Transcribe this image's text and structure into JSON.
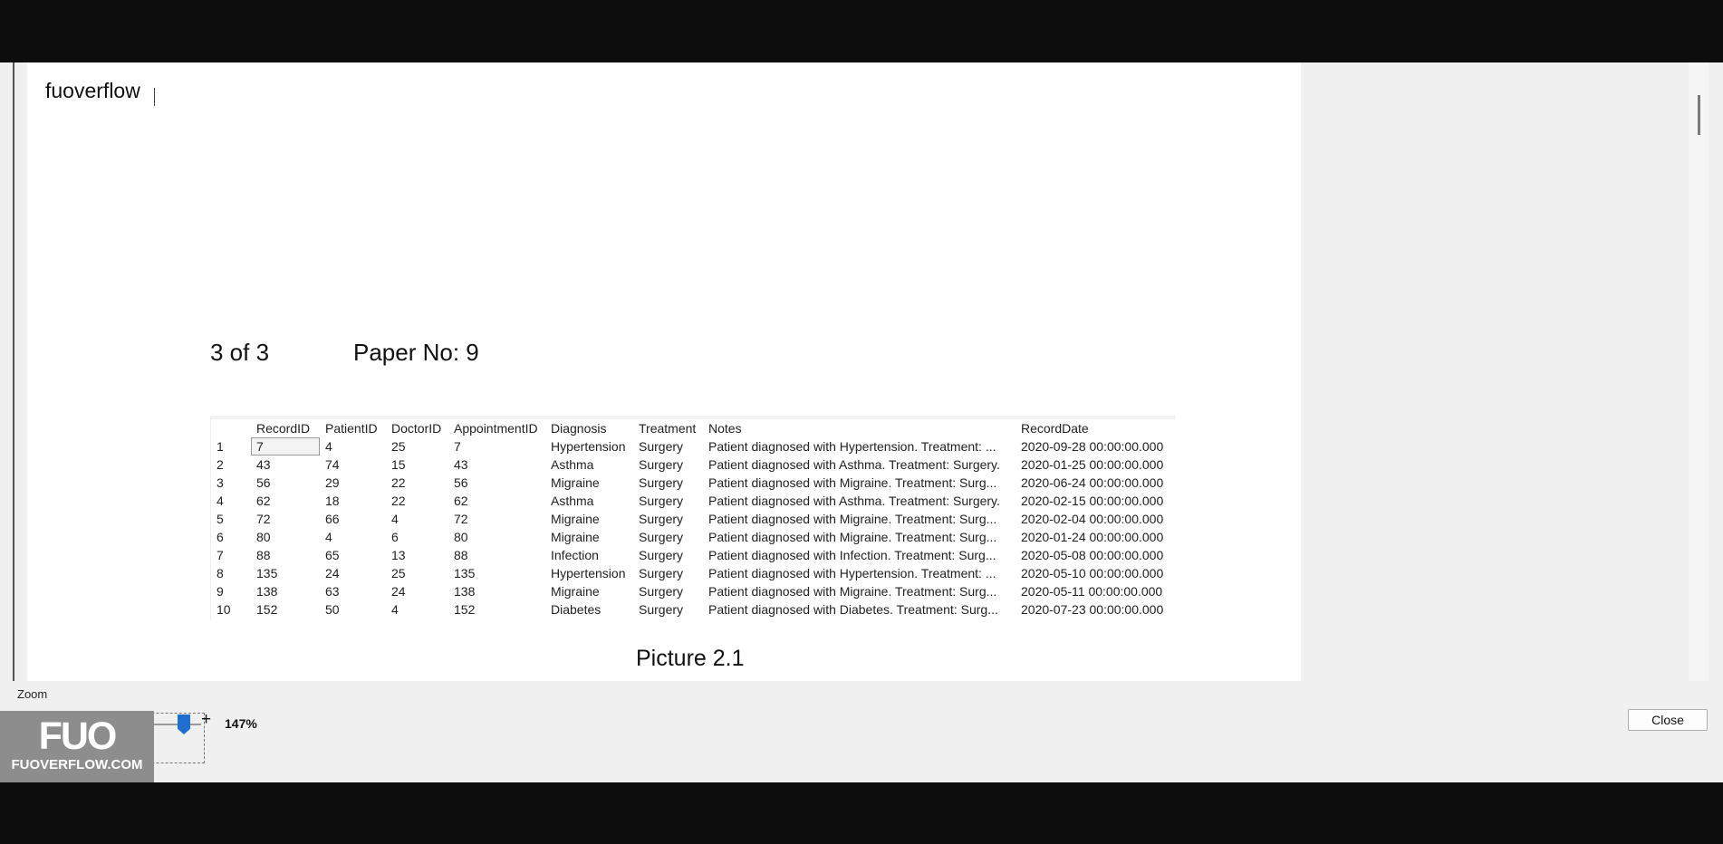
{
  "document": {
    "name": "fuoverflow",
    "page_info": "3 of 3",
    "paper_no": "Paper No: 9",
    "caption": "Picture 2.1"
  },
  "results_grid": {
    "columns": [
      "RecordID",
      "PatientID",
      "DoctorID",
      "AppointmentID",
      "Diagnosis",
      "Treatment",
      "Notes",
      "RecordDate"
    ],
    "rows": [
      [
        "1",
        "7",
        "4",
        "25",
        "7",
        "Hypertension",
        "Surgery",
        "Patient diagnosed with Hypertension. Treatment: ...",
        "2020-09-28 00:00:00.000"
      ],
      [
        "2",
        "43",
        "74",
        "15",
        "43",
        "Asthma",
        "Surgery",
        "Patient diagnosed with Asthma. Treatment: Surgery.",
        "2020-01-25 00:00:00.000"
      ],
      [
        "3",
        "56",
        "29",
        "22",
        "56",
        "Migraine",
        "Surgery",
        "Patient diagnosed with Migraine. Treatment: Surg...",
        "2020-06-24 00:00:00.000"
      ],
      [
        "4",
        "62",
        "18",
        "22",
        "62",
        "Asthma",
        "Surgery",
        "Patient diagnosed with Asthma. Treatment: Surgery.",
        "2020-02-15 00:00:00.000"
      ],
      [
        "5",
        "72",
        "66",
        "4",
        "72",
        "Migraine",
        "Surgery",
        "Patient diagnosed with Migraine. Treatment: Surg...",
        "2020-02-04 00:00:00.000"
      ],
      [
        "6",
        "80",
        "4",
        "6",
        "80",
        "Migraine",
        "Surgery",
        "Patient diagnosed with Migraine. Treatment: Surg...",
        "2020-01-24 00:00:00.000"
      ],
      [
        "7",
        "88",
        "65",
        "13",
        "88",
        "Infection",
        "Surgery",
        "Patient diagnosed with Infection. Treatment: Surg...",
        "2020-05-08 00:00:00.000"
      ],
      [
        "8",
        "135",
        "24",
        "25",
        "135",
        "Hypertension",
        "Surgery",
        "Patient diagnosed with Hypertension. Treatment: ...",
        "2020-05-10 00:00:00.000"
      ],
      [
        "9",
        "138",
        "63",
        "24",
        "138",
        "Migraine",
        "Surgery",
        "Patient diagnosed with Migraine. Treatment: Surg...",
        "2020-05-11 00:00:00.000"
      ],
      [
        "10",
        "152",
        "50",
        "4",
        "152",
        "Diabetes",
        "Surgery",
        "Patient diagnosed with Diabetes. Treatment: Surg...",
        "2020-07-23 00:00:00.000"
      ]
    ]
  },
  "zoom": {
    "label": "Zoom",
    "minus": "-",
    "plus": "+",
    "value": "147%"
  },
  "buttons": {
    "close": "Close"
  },
  "watermark": {
    "logo": "FUO",
    "site": "FUOVERFLOW.COM"
  },
  "colors": {
    "slider_thumb": "#1f6fd1",
    "page": "#ffffff",
    "frame": "#f0f0f0"
  }
}
